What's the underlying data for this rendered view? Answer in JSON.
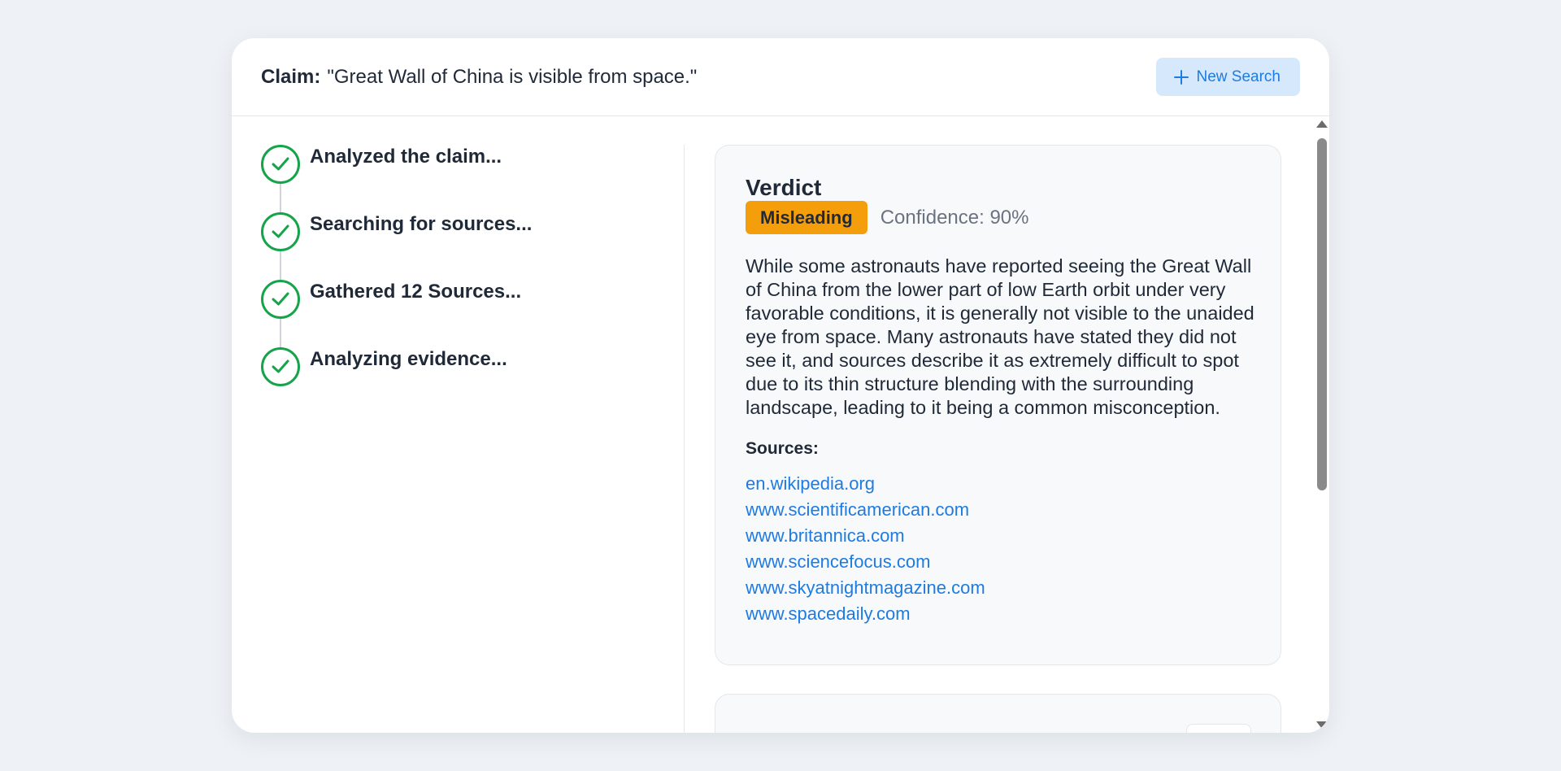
{
  "header": {
    "claim_label": "Claim:",
    "claim_text": "\"Great Wall of China is visible from space.\"",
    "new_search_label": "New Search"
  },
  "steps": [
    {
      "label": "Analyzed the claim...",
      "status": "complete"
    },
    {
      "label": "Searching for sources...",
      "status": "complete"
    },
    {
      "label": "Gathered 12 Sources...",
      "status": "complete"
    },
    {
      "label": "Analyzing evidence...",
      "status": "complete"
    }
  ],
  "verdict": {
    "title": "Verdict",
    "badge": "Misleading",
    "badge_color": "#f59e0b",
    "confidence": "Confidence: 90%",
    "explanation": "While some astronauts have reported seeing the Great Wall of China from the lower part of low Earth orbit under very favorable conditions, it is generally not visible to the unaided eye from space. Many astronauts have stated they did not see it, and sources describe it as extremely difficult to spot due to its thin structure blending with the surrounding landscape, leading to it being a common misconception.",
    "sources_title": "Sources:",
    "sources": [
      "en.wikipedia.org",
      "www.scientificamerican.com",
      "www.britannica.com",
      "www.sciencefocus.com",
      "www.skyatnightmagazine.com",
      "www.spacedaily.com"
    ]
  },
  "colors": {
    "accent": "#1e7be0",
    "success": "#16a34a",
    "warning": "#f59e0b"
  }
}
